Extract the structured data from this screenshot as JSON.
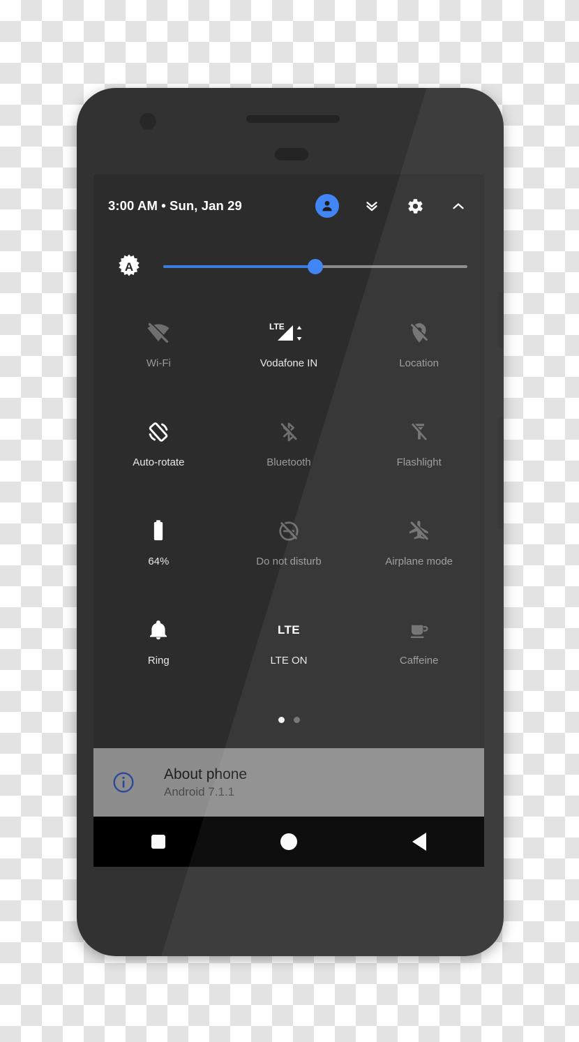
{
  "device": {
    "name": "android-phone-mockup",
    "hardware": {
      "front_camera": "camera-icon",
      "earpiece": "speaker-grille",
      "sensor": "proximity-sensor",
      "power_button": "power-button",
      "volume_button": "volume-rocker"
    }
  },
  "colors": {
    "accent_blue": "#4285f4",
    "slider_fill": "#3b7ddd",
    "screen_bg": "#2c2c2c",
    "phone_body": "#323232",
    "nav_bar": "#000000",
    "about_card": "#8d8d8d",
    "label_on": "#e8e8e8",
    "label_off": "#9a9a9a"
  },
  "status_bar": {
    "time": "3:00 AM",
    "separator": "•",
    "date": "Sun, Jan 29",
    "clock_text": "3:00 AM  •  Sun, Jan 29",
    "icons": [
      {
        "name": "user-avatar",
        "label": "User"
      },
      {
        "name": "chevron-double-down-icon",
        "label": "Expand"
      },
      {
        "name": "gear-icon",
        "label": "Settings"
      },
      {
        "name": "chevron-up-icon",
        "label": "Collapse"
      }
    ]
  },
  "brightness": {
    "icon": "auto-brightness-icon",
    "auto_letter": "A",
    "value_percent": 50,
    "label": "Brightness"
  },
  "tiles": [
    {
      "label": "Wi-Fi",
      "icon": "wifi-off-icon",
      "state": "off"
    },
    {
      "label": "Vodafone IN",
      "icon": "lte-signal-icon",
      "state": "on",
      "badge": "LTE"
    },
    {
      "label": "Location",
      "icon": "location-off-icon",
      "state": "off"
    },
    {
      "label": "Auto-rotate",
      "icon": "auto-rotate-icon",
      "state": "on"
    },
    {
      "label": "Bluetooth",
      "icon": "bluetooth-off-icon",
      "state": "off"
    },
    {
      "label": "Flashlight",
      "icon": "flashlight-off-icon",
      "state": "off"
    },
    {
      "label": "64%",
      "icon": "battery-icon",
      "state": "on"
    },
    {
      "label": "Do not disturb",
      "icon": "do-not-disturb-off-icon",
      "state": "off"
    },
    {
      "label": "Airplane mode",
      "icon": "airplane-off-icon",
      "state": "off"
    },
    {
      "label": "Ring",
      "icon": "bell-icon",
      "state": "on"
    },
    {
      "label": "LTE ON",
      "icon": "lte-text-icon",
      "state": "on",
      "badge": "LTE"
    },
    {
      "label": "Caffeine",
      "icon": "coffee-cup-icon",
      "state": "off"
    }
  ],
  "pager": {
    "total_pages": 2,
    "current_page": 1
  },
  "footer_card": {
    "icon": "info-circle-icon",
    "title": "About phone",
    "subtitle": "Android 7.1.1"
  },
  "nav_bar": {
    "buttons": [
      {
        "name": "recents-button",
        "label": "Recents",
        "shape": "square"
      },
      {
        "name": "home-button",
        "label": "Home",
        "shape": "circle"
      },
      {
        "name": "back-button",
        "label": "Back",
        "shape": "triangle-left"
      }
    ]
  }
}
